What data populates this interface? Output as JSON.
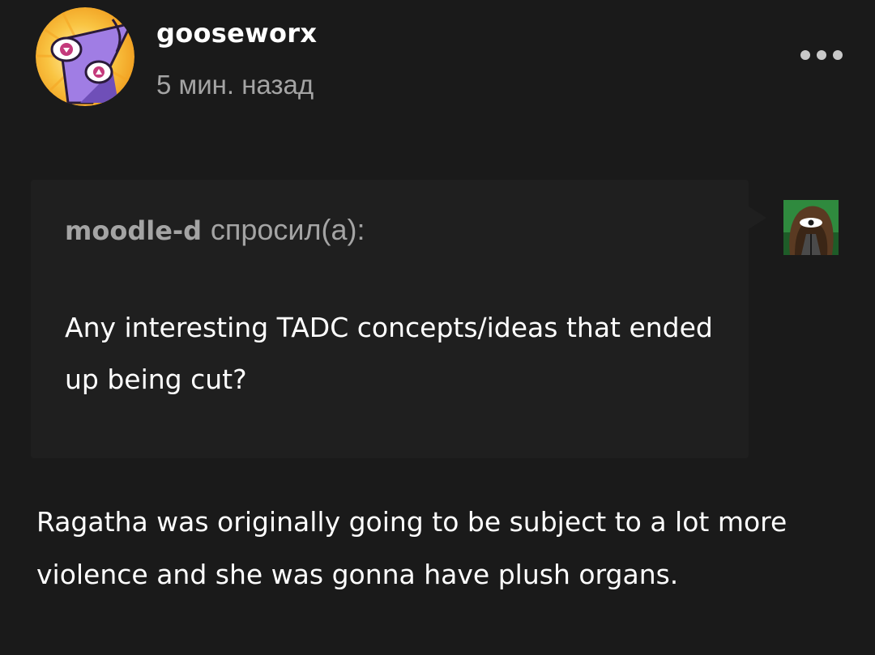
{
  "post": {
    "author": "gooseworx",
    "time_ago": "5 мин. назад",
    "author_avatar_icon": "purple-eyed-character-avatar-icon",
    "more_icon": "ellipsis-icon"
  },
  "ask": {
    "asker": "moodle-d",
    "asked_label": "спросил(а):",
    "question": "Any interesting TADC concepts/ideas that ended up being cut?",
    "asker_avatar_icon": "asker-avatar-icon"
  },
  "answer": {
    "text": "Ragatha was originally going to be subject to a lot more violence and she was gonna have plush organs."
  },
  "colors": {
    "background": "#1a1a1a",
    "ask_box": "#1f1f1f",
    "muted_text": "#a4a4a4",
    "primary_text": "#ffffff",
    "avatar_orange": "#f6b42e",
    "avatar_purple": "#a07de4"
  }
}
